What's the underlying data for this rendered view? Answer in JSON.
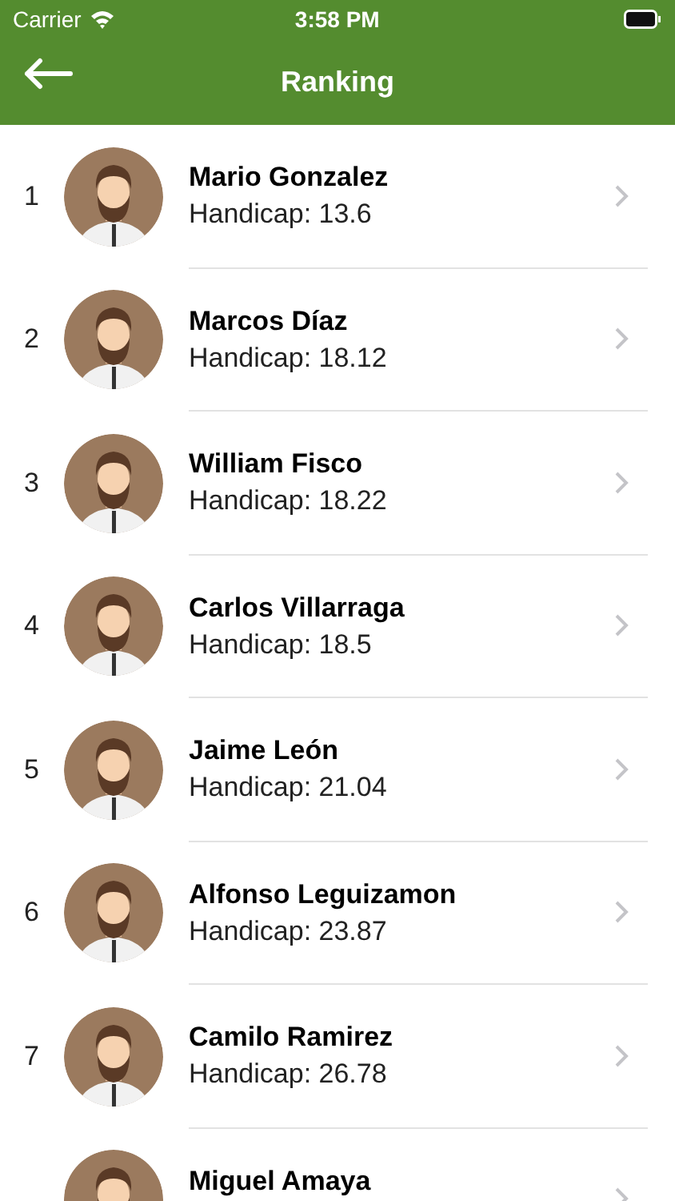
{
  "status_bar": {
    "carrier": "Carrier",
    "time": "3:58 PM"
  },
  "nav": {
    "title": "Ranking"
  },
  "players": [
    {
      "rank": "1",
      "name": "Mario Gonzalez",
      "handicap": "Handicap: 13.6"
    },
    {
      "rank": "2",
      "name": "Marcos Díaz",
      "handicap": "Handicap: 18.12"
    },
    {
      "rank": "3",
      "name": "William Fisco",
      "handicap": "Handicap: 18.22"
    },
    {
      "rank": "4",
      "name": "Carlos Villarraga",
      "handicap": "Handicap: 18.5"
    },
    {
      "rank": "5",
      "name": "Jaime León",
      "handicap": "Handicap: 21.04"
    },
    {
      "rank": "6",
      "name": "Alfonso Leguizamon",
      "handicap": "Handicap: 23.87"
    },
    {
      "rank": "7",
      "name": "Camilo Ramirez",
      "handicap": "Handicap: 26.78"
    },
    {
      "name": "Miguel Amaya"
    }
  ]
}
